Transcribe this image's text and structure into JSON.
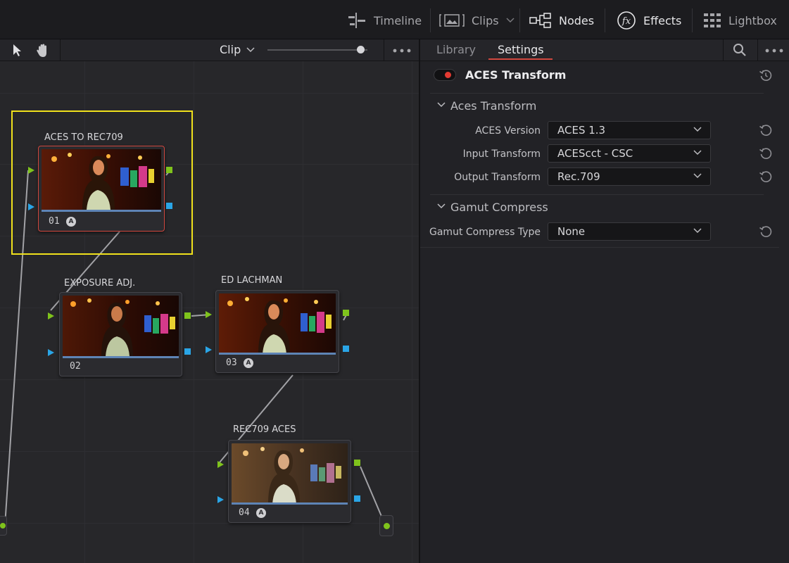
{
  "topbar": {
    "items": [
      {
        "label": "Timeline",
        "icon": "timeline-icon",
        "active": false
      },
      {
        "label": "Clips",
        "icon": "clips-icon",
        "active": false
      },
      {
        "label": "Nodes",
        "icon": "nodes-icon",
        "active": true
      },
      {
        "label": "Effects",
        "icon": "effects-fx-icon",
        "active": true
      },
      {
        "label": "Lightbox",
        "icon": "lightbox-grid-icon",
        "active": false
      }
    ]
  },
  "node_toolbar": {
    "mode": "Clip",
    "zoom_fraction": 0.9,
    "tools": [
      "pointer-icon",
      "hand-icon"
    ]
  },
  "nodes": [
    {
      "label": "ACES TO REC709",
      "number": "01",
      "has_aces_icon": true,
      "selected": true
    },
    {
      "label": "EXPOSURE ADJ.",
      "number": "02",
      "has_aces_icon": false,
      "selected": false
    },
    {
      "label": "ED LACHMAN",
      "number": "03",
      "has_aces_icon": true,
      "selected": false
    },
    {
      "label": "REC709 ACES",
      "number": "04",
      "has_aces_icon": true,
      "selected": false
    }
  ],
  "right_panel": {
    "tabs": [
      {
        "label": "Library",
        "active": false
      },
      {
        "label": "Settings",
        "active": true
      }
    ],
    "effect": {
      "title": "ACES Transform",
      "enabled": true
    },
    "sections": [
      {
        "title": "Aces Transform",
        "expanded": true,
        "fields": [
          {
            "label": "ACES Version",
            "value": "ACES 1.3"
          },
          {
            "label": "Input Transform",
            "value": "ACEScct - CSC"
          },
          {
            "label": "Output Transform",
            "value": "Rec.709"
          }
        ]
      },
      {
        "title": "Gamut Compress",
        "expanded": true,
        "fields": [
          {
            "label": "Gamut Compress Type",
            "value": "None"
          }
        ]
      }
    ]
  },
  "colors": {
    "accent_red": "#d0473e",
    "selection_yellow": "#f0e11c",
    "rgb_connector": "#7fc31c",
    "key_connector": "#2aa5e6"
  }
}
